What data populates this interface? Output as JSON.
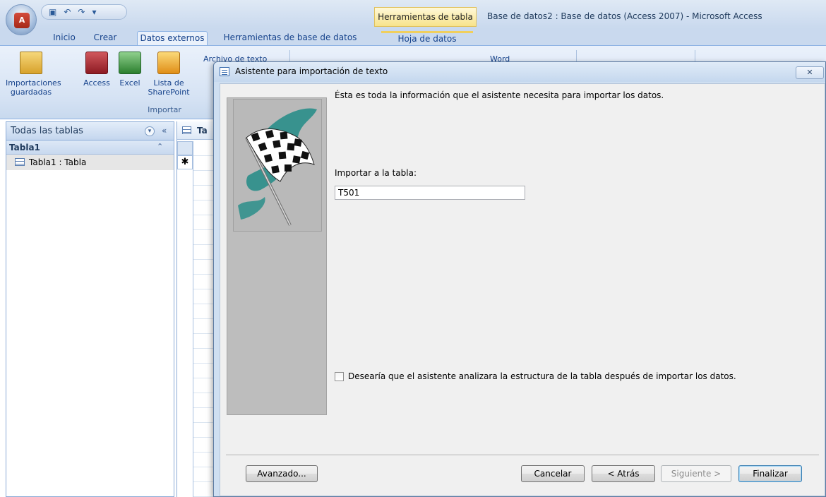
{
  "window": {
    "contextual_group": "Herramientas de tabla",
    "title": "Base de datos2 : Base de datos (Access 2007) - Microsoft Access"
  },
  "ribbon": {
    "tabs": [
      {
        "label": "Inicio"
      },
      {
        "label": "Crear"
      },
      {
        "label": "Datos externos"
      },
      {
        "label": "Herramientas de base de datos"
      },
      {
        "label": "Hoja de datos"
      }
    ],
    "import_group": {
      "saved_imports": "Importaciones guardadas",
      "access": "Access",
      "excel": "Excel",
      "sharepoint": "Lista de SharePoint",
      "text_file": "Archivo de texto",
      "group_label": "Importar"
    },
    "word": "Word"
  },
  "navigation": {
    "header": "Todas las tablas",
    "group": "Tabla1",
    "item": "Tabla1 : Tabla"
  },
  "datasheet": {
    "tab_label": "Ta",
    "new_row_marker": "✱"
  },
  "dialog": {
    "title": "Asistente para importación de texto",
    "close_glyph": "✕",
    "message": "Ésta es toda la información que el asistente necesita para importar los datos.",
    "import_label": "Importar a la tabla:",
    "import_value": "T501",
    "analyze_label": "Desearía que el asistente analizara la estructura de la tabla después de importar los datos.",
    "buttons": {
      "advanced": "Avanzado...",
      "cancel": "Cancelar",
      "back": "< Atrás",
      "next": "Siguiente >",
      "finish": "Finalizar"
    }
  }
}
